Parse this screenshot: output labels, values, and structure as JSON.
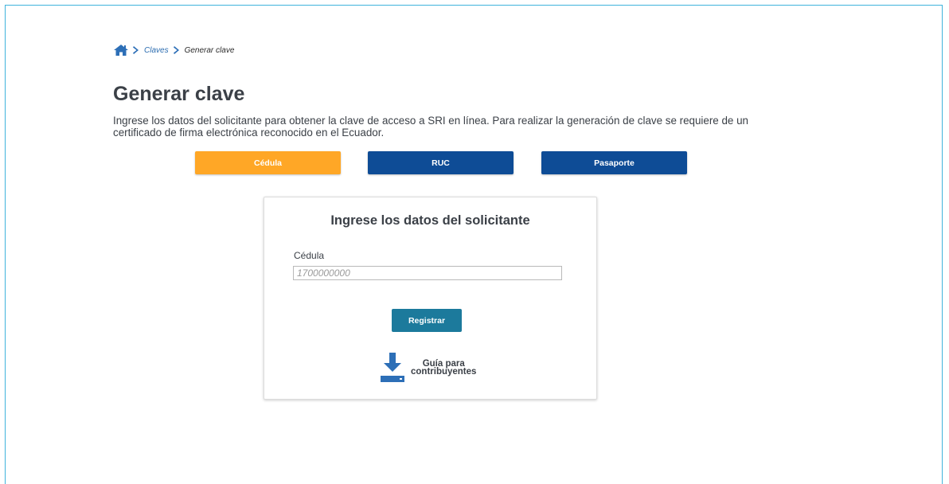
{
  "breadcrumb": {
    "items": [
      "Claves",
      "Generar clave"
    ]
  },
  "page": {
    "title": "Generar clave",
    "description": "Ingrese los datos del solicitante para obtener la clave de acceso a SRI en línea. Para realizar la generación de clave se requiere de un certificado de firma electrónica reconocido en el Ecuador."
  },
  "doc_types": {
    "selected": "Cédula",
    "options": [
      "Cédula",
      "RUC",
      "Pasaporte"
    ]
  },
  "form": {
    "title": "Ingrese los datos del solicitante",
    "field_label": "Cédula",
    "field_placeholder": "1700000000",
    "field_value": "",
    "submit_label": "Registrar",
    "guide_line1": "Guía para",
    "guide_line2": "contribuyentes"
  },
  "colors": {
    "frame_border": "#3fb3dc",
    "active_tab": "#ffa726",
    "inactive_tab": "#0e4c96",
    "submit": "#1c7a9c",
    "icon_blue": "#2d6fb7"
  }
}
